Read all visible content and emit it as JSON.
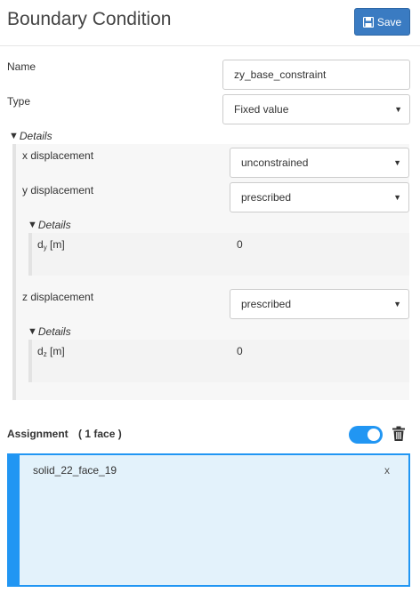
{
  "header": {
    "title": "Boundary Condition",
    "save_label": "Save"
  },
  "form": {
    "name_label": "Name",
    "name_value": "zy_base_constraint",
    "type_label": "Type",
    "type_value": "Fixed value",
    "details_label": "Details"
  },
  "details": {
    "x_label": "x displacement",
    "x_value": "unconstrained",
    "y_label": "y displacement",
    "y_value": "prescribed",
    "y_details_label": "Details",
    "dy_symbol": "d",
    "dy_sub": "y",
    "dy_unit": "[m]",
    "dy_value": "0",
    "z_label": "z displacement",
    "z_value": "prescribed",
    "z_details_label": "Details",
    "dz_symbol": "d",
    "dz_sub": "z",
    "dz_unit": "[m]",
    "dz_value": "0"
  },
  "assignment": {
    "title": "Assignment",
    "count": "( 1 face )",
    "toggle_on": true,
    "items": [
      {
        "label": "solid_22_face_19",
        "remove": "x"
      }
    ]
  },
  "colors": {
    "accent": "#2196f3",
    "save": "#3a7bc2",
    "assign_bg": "#e3f2fb"
  },
  "icons": {
    "save": "floppy-disk-icon",
    "trash": "trash-icon",
    "triangle": "caret-down-icon"
  }
}
